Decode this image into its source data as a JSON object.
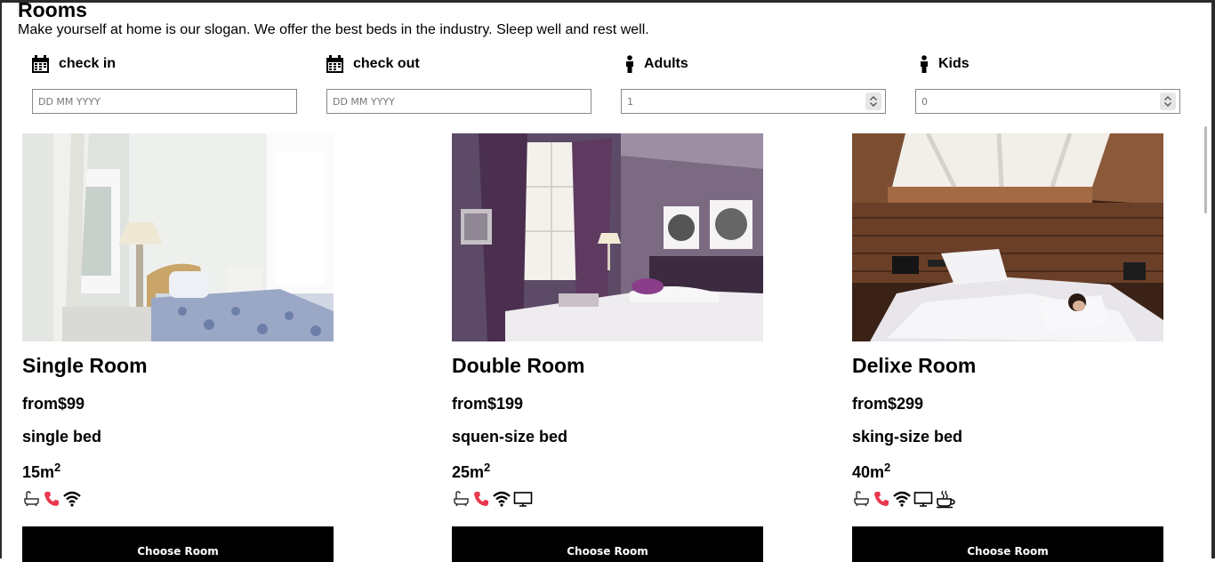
{
  "page": {
    "title": "Rooms",
    "slogan": "Make yourself at home is our slogan. We offer the best beds in the industry. Sleep well and rest well."
  },
  "booking": {
    "check_in": {
      "label": "check in",
      "placeholder": "DD MM YYYY",
      "icon": "calendar-icon"
    },
    "check_out": {
      "label": "check out",
      "placeholder": "DD MM YYYY",
      "icon": "calendar-icon"
    },
    "adults": {
      "label": "Adults",
      "value": "1",
      "icon": "person-icon"
    },
    "kids": {
      "label": "Kids",
      "value": "0",
      "icon": "person-icon"
    }
  },
  "rooms": [
    {
      "name": "Single Room",
      "price": "from$99",
      "bed": "single bed",
      "area": "15m",
      "area_unit_sup": "2",
      "amenities": [
        "bath-icon",
        "phone-icon",
        "wifi-icon"
      ],
      "button_label": "Choose Room"
    },
    {
      "name": "Double Room",
      "price": "from$199",
      "bed": "squen-size bed",
      "area": "25m",
      "area_unit_sup": "2",
      "amenities": [
        "bath-icon",
        "phone-icon",
        "wifi-icon",
        "tv-icon"
      ],
      "button_label": "Choose Room"
    },
    {
      "name": "Delixe Room",
      "price": "from$299",
      "bed": "sking-size bed",
      "area": "40m",
      "area_unit_sup": "2",
      "amenities": [
        "bath-icon",
        "phone-icon",
        "wifi-icon",
        "tv-icon",
        "coffee-icon"
      ],
      "button_label": "Choose Room"
    }
  ],
  "colors": {
    "button_bg": "#000000",
    "button_text": "#ffffff",
    "phone_icon": "#e8384f",
    "input_border": "#888888"
  }
}
